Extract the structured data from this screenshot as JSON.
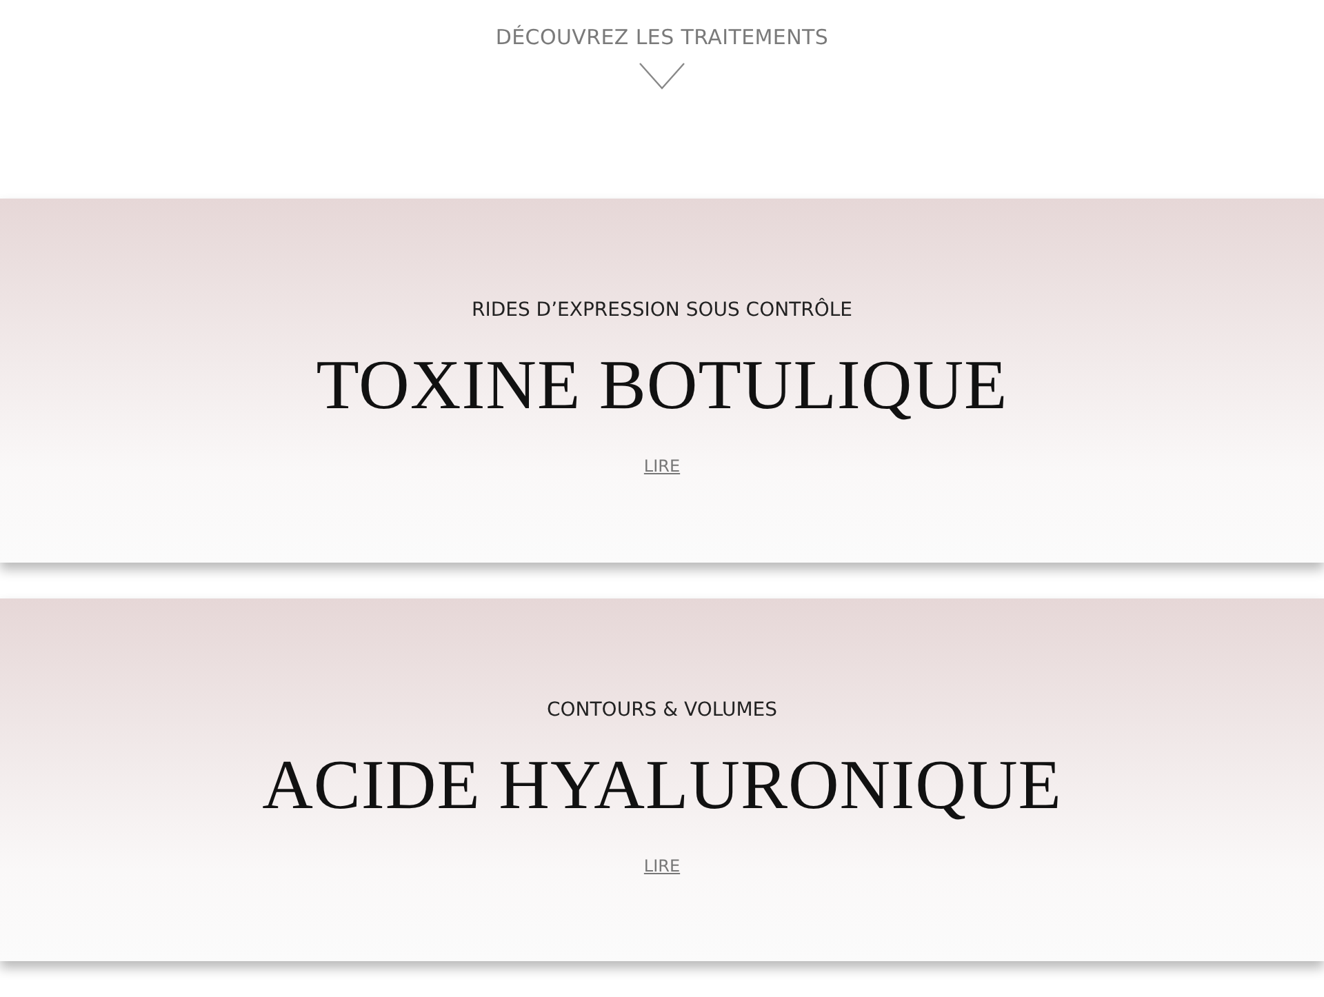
{
  "intro": {
    "label": "DÉCOUVREZ LES TRAITEMENTS"
  },
  "treatments": [
    {
      "tagline": "RIDES D’EXPRESSION SOUS CONTRÔLE",
      "title": "TOXINE BOTULIQUE",
      "link": "LIRE"
    },
    {
      "tagline": "CONTOURS & VOLUMES",
      "title": "ACIDE HYALURONIQUE",
      "link": "LIRE"
    }
  ]
}
